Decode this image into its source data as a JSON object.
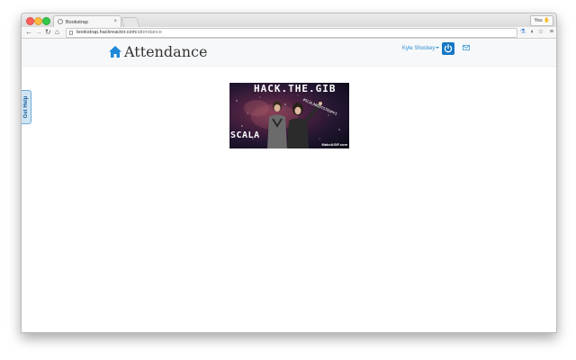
{
  "browser": {
    "tab_title": "Bookstrap",
    "tab_close": "×",
    "user_button": "You",
    "user_button_icon": "✋",
    "url_domain": "bookstrap.hackreactor.com",
    "url_path": "/attendance",
    "nav": {
      "back": "←",
      "forward": "→",
      "reload": "↻",
      "home": "⌂"
    },
    "extensions": {
      "e1": "⚗",
      "e2": "◐",
      "e3": "☆",
      "e4": "≡"
    }
  },
  "header": {
    "title": "Attendance",
    "user_name": "Kyle Shockey",
    "accent_color": "#1677c5"
  },
  "get_help": {
    "label": "Get Help"
  },
  "hero": {
    "top_text": "HACK.THE.GIB",
    "bottom_text": "SCALA",
    "diagonal_text": "#SCALABOOTSTRAPPI",
    "watermark": "MakeAGIF.com"
  }
}
